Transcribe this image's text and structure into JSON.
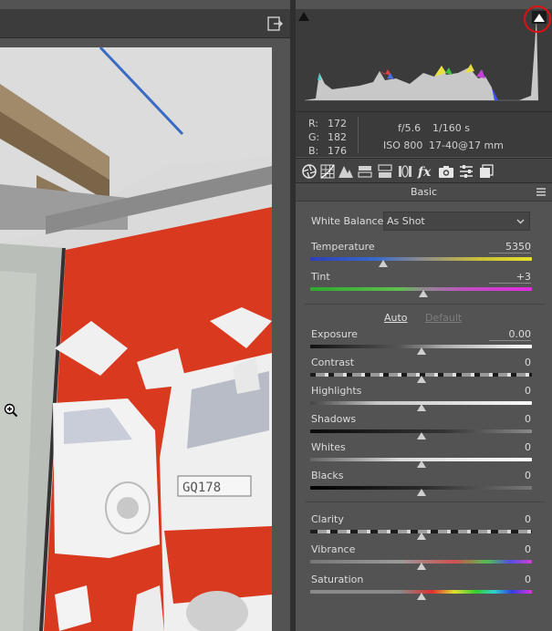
{
  "histogram": {
    "rgb": [
      {
        "key": "R:",
        "value": "172"
      },
      {
        "key": "G:",
        "value": "182"
      },
      {
        "key": "B:",
        "value": "176"
      }
    ],
    "camera": {
      "aperture": "f/5.6",
      "shutter": "1/160 s",
      "iso": "ISO 800",
      "lens": "17-40@17 mm"
    }
  },
  "tabs": [
    {
      "name": "basic",
      "icon": "aperture-icon"
    },
    {
      "name": "tone-curve",
      "icon": "grid-icon"
    },
    {
      "name": "detail",
      "icon": "mountains-icon"
    },
    {
      "name": "hsl",
      "icon": "split-bars-icon"
    },
    {
      "name": "split-toning",
      "icon": "split-toning-icon"
    },
    {
      "name": "lens-corrections",
      "icon": "lens-icon"
    },
    {
      "name": "effects",
      "icon": "fx-icon"
    },
    {
      "name": "camera-calibration",
      "icon": "camera-icon"
    },
    {
      "name": "presets",
      "icon": "sliders-icon"
    },
    {
      "name": "snapshots",
      "icon": "snapshots-icon"
    }
  ],
  "panel": {
    "title": "Basic",
    "white_balance": {
      "label": "White Balance:",
      "value": "As Shot"
    },
    "temperature": {
      "label": "Temperature",
      "value": "5350",
      "fraction": 0.33
    },
    "tint": {
      "label": "Tint",
      "value": "+3",
      "fraction": 0.51
    },
    "auto_label": "Auto",
    "default_label": "Default",
    "tone": [
      {
        "label": "Exposure",
        "value": "0.00",
        "fraction": 0.5
      },
      {
        "label": "Contrast",
        "value": "0",
        "fraction": 0.5
      },
      {
        "label": "Highlights",
        "value": "0",
        "fraction": 0.5
      },
      {
        "label": "Shadows",
        "value": "0",
        "fraction": 0.5
      },
      {
        "label": "Whites",
        "value": "0",
        "fraction": 0.5
      },
      {
        "label": "Blacks",
        "value": "0",
        "fraction": 0.5
      }
    ],
    "presence": [
      {
        "label": "Clarity",
        "value": "0",
        "fraction": 0.5
      },
      {
        "label": "Vibrance",
        "value": "0",
        "fraction": 0.5
      },
      {
        "label": "Saturation",
        "value": "0",
        "fraction": 0.5
      }
    ]
  },
  "colors": {
    "clipping_overlay": "#d9391f",
    "clip_warning_ring": "#e01010"
  }
}
